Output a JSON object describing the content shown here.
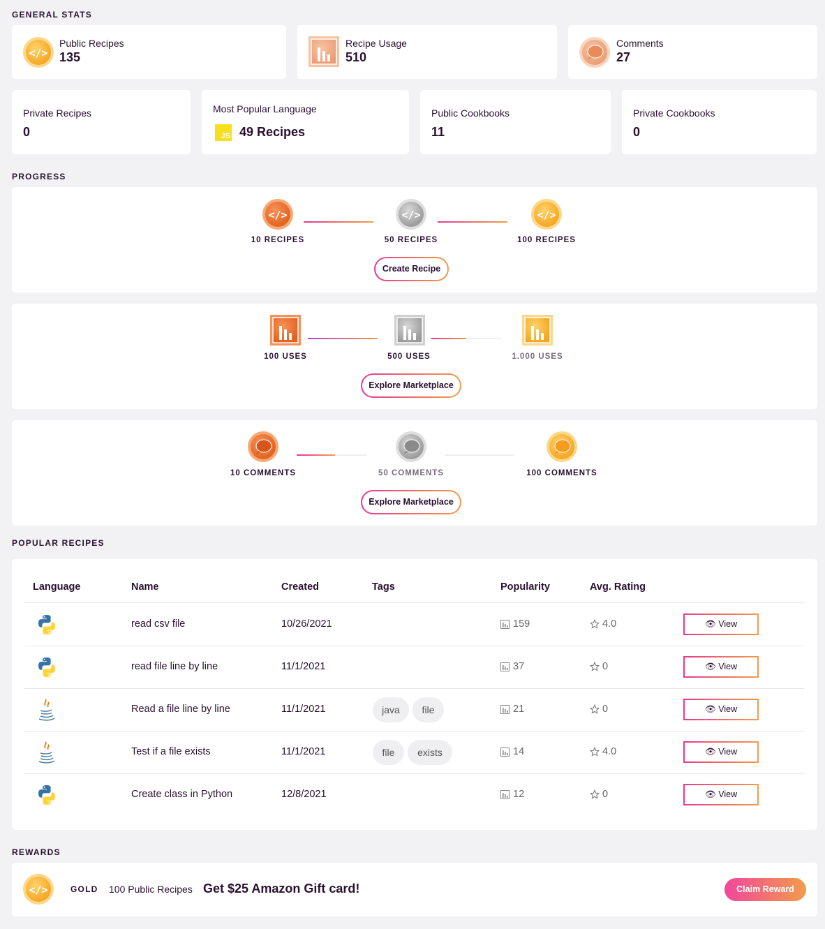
{
  "sections": {
    "general_stats": "GENERAL STATS",
    "progress": "PROGRESS",
    "popular_recipes": "POPULAR RECIPES",
    "rewards": "REWARDS"
  },
  "stats_top": [
    {
      "label": "Public Recipes",
      "value": "135",
      "icon": "code-badge-icon"
    },
    {
      "label": "Recipe Usage",
      "value": "510",
      "icon": "bar-chart-icon"
    },
    {
      "label": "Comments",
      "value": "27",
      "icon": "comment-bubble-icon"
    }
  ],
  "stats_bottom": [
    {
      "label": "Private Recipes",
      "value": "0"
    },
    {
      "label": "Most Popular Language",
      "value": "49 Recipes",
      "icon": "javascript-icon",
      "icon_text": "JS"
    },
    {
      "label": "Public Cookbooks",
      "value": "11"
    },
    {
      "label": "Private Cookbooks",
      "value": "0"
    }
  ],
  "progress": {
    "recipes": {
      "milestones": [
        "10 RECIPES",
        "50 RECIPES",
        "100 RECIPES"
      ],
      "button": "Create Recipe"
    },
    "uses": {
      "milestones": [
        "100 USES",
        "500 USES",
        "1.000 USES"
      ],
      "button": "Explore Marketplace"
    },
    "comments": {
      "milestones": [
        "10 COMMENTS",
        "50 COMMENTS",
        "100 COMMENTS"
      ],
      "button": "Explore Marketplace"
    }
  },
  "table": {
    "headers": [
      "Language",
      "Name",
      "Created",
      "Tags",
      "Popularity",
      "Avg. Rating"
    ],
    "rows": [
      {
        "language": "python",
        "name": "read csv file",
        "created": "10/26/2021",
        "tags": [],
        "popularity": "159",
        "rating": "4.0",
        "action": "View"
      },
      {
        "language": "python",
        "name": "read file line by line",
        "created": "11/1/2021",
        "tags": [],
        "popularity": "37",
        "rating": "0",
        "action": "View"
      },
      {
        "language": "java",
        "name": "Read a file line by line",
        "created": "11/1/2021",
        "tags": [
          "java",
          "file"
        ],
        "popularity": "21",
        "rating": "0",
        "action": "View"
      },
      {
        "language": "java",
        "name": "Test if a file exists",
        "created": "11/1/2021",
        "tags": [
          "file",
          "exists"
        ],
        "popularity": "14",
        "rating": "4.0",
        "action": "View"
      },
      {
        "language": "python",
        "name": "Create class in Python",
        "created": "12/8/2021",
        "tags": [],
        "popularity": "12",
        "rating": "0",
        "action": "View"
      }
    ]
  },
  "reward": {
    "tier": "GOLD",
    "requirement": "100 Public Recipes",
    "prize": "Get $25 Amazon Gift card!",
    "button": "Claim Reward"
  },
  "colors": {
    "accent_pink": "#e8398e",
    "accent_orange": "#f39c4b",
    "text_dark": "#2a1030",
    "gold": "#f7b731",
    "bronze": "#ee7a2e",
    "silver": "#b0b0b0"
  }
}
